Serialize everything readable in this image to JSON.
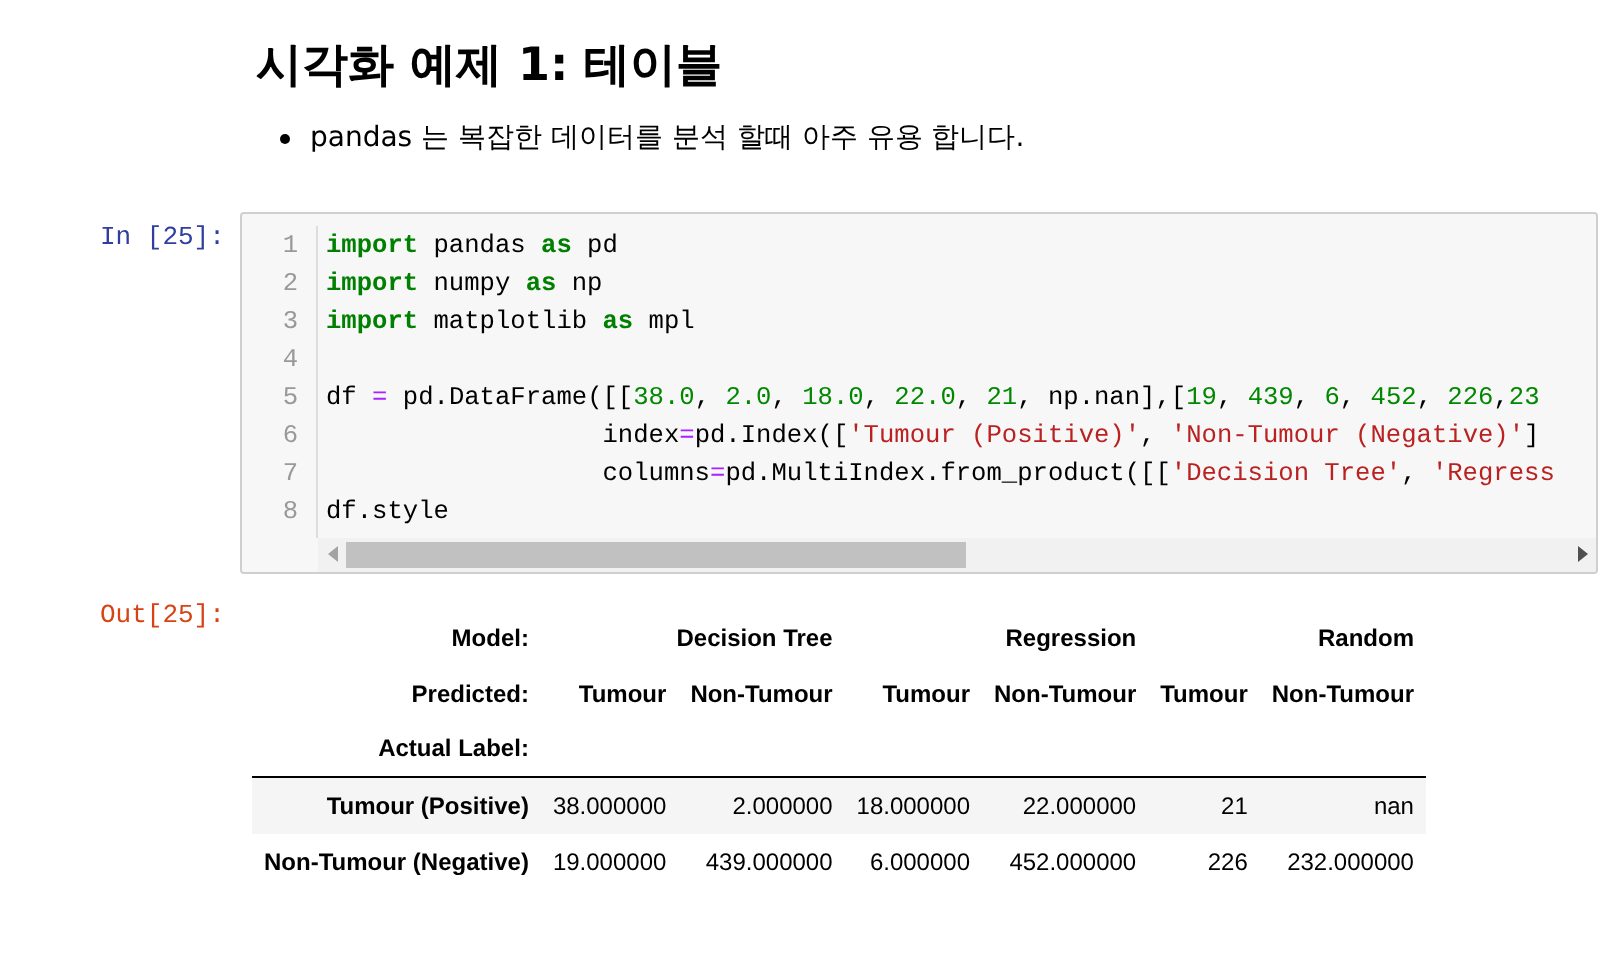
{
  "heading": "시각화 예제 1: 테이블",
  "bullets": [
    "pandas 는 복잡한 데이터를 분석 할때 아주 유용 합니다."
  ],
  "input_prompt": "In [25]:",
  "code_lines": [
    {
      "number": "1",
      "tokens": [
        {
          "kind": "kw",
          "text": "import"
        },
        {
          "kind": "plain",
          "text": " pandas "
        },
        {
          "kind": "kw",
          "text": "as"
        },
        {
          "kind": "plain",
          "text": " pd"
        }
      ]
    },
    {
      "number": "2",
      "tokens": [
        {
          "kind": "kw",
          "text": "import"
        },
        {
          "kind": "plain",
          "text": " numpy "
        },
        {
          "kind": "kw",
          "text": "as"
        },
        {
          "kind": "plain",
          "text": " np"
        }
      ]
    },
    {
      "number": "3",
      "tokens": [
        {
          "kind": "kw",
          "text": "import"
        },
        {
          "kind": "plain",
          "text": " matplotlib "
        },
        {
          "kind": "kw",
          "text": "as"
        },
        {
          "kind": "plain",
          "text": " mpl"
        }
      ]
    },
    {
      "number": "4"
    },
    {
      "number": "5",
      "tokens": [
        {
          "kind": "plain",
          "text": "df "
        },
        {
          "kind": "op",
          "text": "="
        },
        {
          "kind": "plain",
          "text": " pd.DataFrame([["
        },
        {
          "kind": "num",
          "text": "38.0"
        },
        {
          "kind": "plain",
          "text": ", "
        },
        {
          "kind": "num",
          "text": "2.0"
        },
        {
          "kind": "plain",
          "text": ", "
        },
        {
          "kind": "num",
          "text": "18.0"
        },
        {
          "kind": "plain",
          "text": ", "
        },
        {
          "kind": "num",
          "text": "22.0"
        },
        {
          "kind": "plain",
          "text": ", "
        },
        {
          "kind": "num",
          "text": "21"
        },
        {
          "kind": "plain",
          "text": ", np.nan],["
        },
        {
          "kind": "num",
          "text": "19"
        },
        {
          "kind": "plain",
          "text": ", "
        },
        {
          "kind": "num",
          "text": "439"
        },
        {
          "kind": "plain",
          "text": ", "
        },
        {
          "kind": "num",
          "text": "6"
        },
        {
          "kind": "plain",
          "text": ", "
        },
        {
          "kind": "num",
          "text": "452"
        },
        {
          "kind": "plain",
          "text": ", "
        },
        {
          "kind": "num",
          "text": "226"
        },
        {
          "kind": "plain",
          "text": ","
        },
        {
          "kind": "num",
          "text": "23"
        }
      ]
    },
    {
      "number": "6",
      "tokens": [
        {
          "kind": "plain",
          "text": "                  index"
        },
        {
          "kind": "op",
          "text": "="
        },
        {
          "kind": "plain",
          "text": "pd.Index(["
        },
        {
          "kind": "str",
          "text": "'Tumour (Positive)'"
        },
        {
          "kind": "plain",
          "text": ", "
        },
        {
          "kind": "str",
          "text": "'Non-Tumour (Negative)'"
        },
        {
          "kind": "plain",
          "text": "]"
        }
      ]
    },
    {
      "number": "7",
      "tokens": [
        {
          "kind": "plain",
          "text": "                  columns"
        },
        {
          "kind": "op",
          "text": "="
        },
        {
          "kind": "plain",
          "text": "pd.MultiIndex.from_product([["
        },
        {
          "kind": "str",
          "text": "'Decision Tree'"
        },
        {
          "kind": "plain",
          "text": ", "
        },
        {
          "kind": "str",
          "text": "'Regress"
        }
      ]
    },
    {
      "number": "8",
      "tokens": [
        {
          "kind": "plain",
          "text": "df.style"
        }
      ]
    }
  ],
  "output_prompt": "Out[25]:",
  "table": {
    "model_label": "Model:",
    "predicted_label": "Predicted:",
    "actual_label": "Actual Label:",
    "models": [
      {
        "name": "Decision Tree",
        "predicted": [
          "Tumour",
          "Non-Tumour"
        ]
      },
      {
        "name": "Regression",
        "predicted": [
          "Tumour",
          "Non-Tumour"
        ]
      },
      {
        "name": "Random",
        "predicted": [
          "Tumour",
          "Non-Tumour"
        ]
      }
    ],
    "rows": [
      {
        "label": "Tumour (Positive)",
        "cells": [
          "38.000000",
          "2.000000",
          "18.000000",
          "22.000000",
          "21",
          "nan"
        ]
      },
      {
        "label": "Non-Tumour (Negative)",
        "cells": [
          "19.000000",
          "439.000000",
          "6.000000",
          "452.000000",
          "226",
          "232.000000"
        ]
      }
    ]
  }
}
